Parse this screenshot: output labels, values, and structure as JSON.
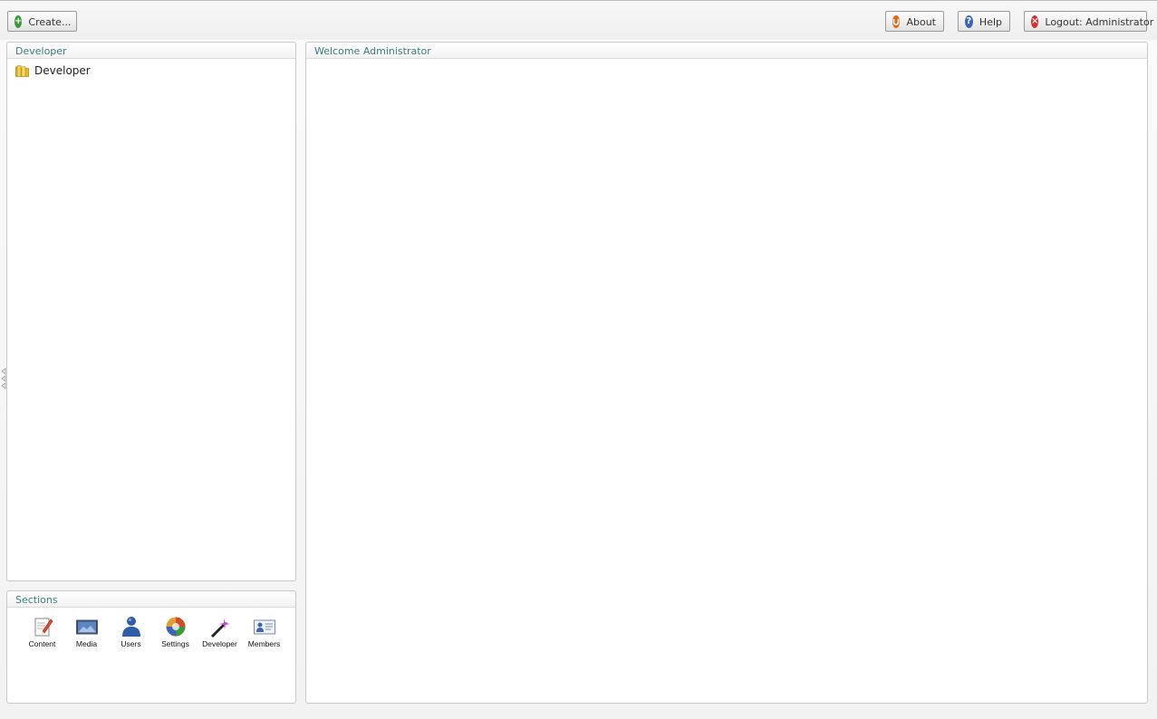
{
  "toolbar": {
    "create_label": "Create...",
    "about_label": "About",
    "help_label": "Help",
    "logout_label": "Logout: Administrator"
  },
  "tree_panel": {
    "title": "Developer",
    "items": [
      {
        "label": "Developer"
      }
    ]
  },
  "sections_panel": {
    "title": "Sections",
    "items": [
      {
        "label": "Content",
        "icon": "content-icon"
      },
      {
        "label": "Media",
        "icon": "media-icon"
      },
      {
        "label": "Users",
        "icon": "users-icon"
      },
      {
        "label": "Settings",
        "icon": "settings-icon"
      },
      {
        "label": "Developer",
        "icon": "developer-icon"
      },
      {
        "label": "Members",
        "icon": "members-icon"
      }
    ]
  },
  "main_panel": {
    "title": "Welcome Administrator"
  },
  "colors": {
    "panel_title": "#3c7d7a",
    "create_icon": "#3a9a3a",
    "about_icon": "#e06a1a",
    "help_icon": "#3b66b5",
    "logout_icon": "#d23030"
  }
}
